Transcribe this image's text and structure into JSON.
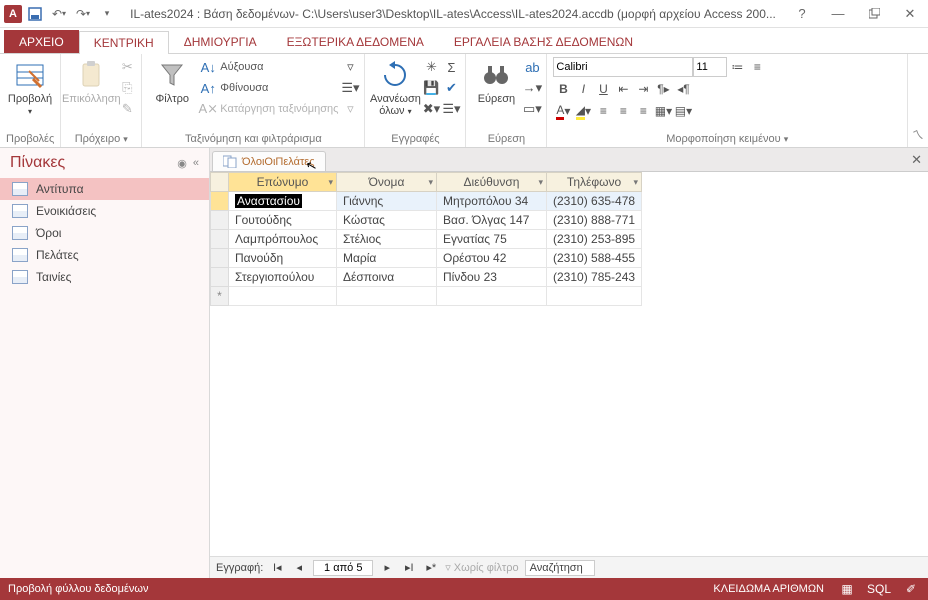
{
  "titlebar": {
    "app_glyph": "A",
    "title": "IL-ates2024 : Βάση δεδομένων- C:\\Users\\user3\\Desktop\\IL-ates\\Access\\IL-ates2024.accdb (μορφή αρχείου Access 200...",
    "help": "?"
  },
  "tabs": {
    "file": "ΑΡΧΕΙΟ",
    "home": "ΚΕΝΤΡΙΚΗ",
    "create": "ΔΗΜΙΟΥΡΓΙΑ",
    "external": "ΕΞΩΤΕΡΙΚΑ ΔΕΔΟΜΕΝΑ",
    "dbtools": "ΕΡΓΑΛΕΙΑ ΒΑΣΗΣ ΔΕΔΟΜΕΝΩΝ"
  },
  "ribbon": {
    "views": {
      "view": "Προβολή",
      "group": "Προβολές"
    },
    "clipboard": {
      "paste": "Επικόλληση",
      "group": "Πρόχειρο"
    },
    "sortfilter": {
      "filter": "Φίλτρο",
      "asc": "Αύξουσα",
      "desc": "Φθίνουσα",
      "clear_sort": "Κατάργηση ταξινόμησης",
      "group": "Ταξινόμηση και φιλτράρισμα"
    },
    "records": {
      "refresh": "Ανανέωση όλων",
      "group": "Εγγραφές"
    },
    "find": {
      "find": "Εύρεση",
      "group": "Εύρεση"
    },
    "textfmt": {
      "font_name": "Calibri",
      "font_size": "11",
      "group": "Μορφοποίηση κειμένου"
    }
  },
  "navpane": {
    "title": "Πίνακες",
    "items": [
      "Αντίτυπα",
      "Ενοικιάσεις",
      "Όροι",
      "Πελάτες",
      "Ταινίες"
    ],
    "selected_index": 0
  },
  "document": {
    "tab_label": "ΌλοιΟιΠελάτες",
    "columns": [
      "Επώνυμο",
      "Όνομα",
      "Διεύθυνση",
      "Τηλέφωνο"
    ],
    "rows": [
      {
        "lastname": "Αναστασίου",
        "firstname": "Γιάννης",
        "address": "Μητροπόλου 34",
        "phone": "(2310) 635-478"
      },
      {
        "lastname": "Γουτούδης",
        "firstname": "Κώστας",
        "address": "Βασ. Όλγας 147",
        "phone": "(2310) 888-771"
      },
      {
        "lastname": "Λαμπρόπουλος",
        "firstname": "Στέλιος",
        "address": "Εγνατίας 75",
        "phone": "(2310) 253-895"
      },
      {
        "lastname": "Πανούδη",
        "firstname": "Μαρία",
        "address": "Ορέστου 42",
        "phone": "(2310) 588-455"
      },
      {
        "lastname": "Στεργιοπούλου",
        "firstname": "Δέσποινα",
        "address": "Πίνδου 23",
        "phone": "(2310) 785-243"
      }
    ],
    "newrow_marker": "*"
  },
  "recnav": {
    "label": "Εγγραφή:",
    "position": "1 από 5",
    "no_filter": "Χωρίς φίλτρο",
    "search": "Αναζήτηση"
  },
  "statusbar": {
    "left": "Προβολή φύλλου δεδομένων",
    "caps": "ΚΛΕΙΔΩΜΑ ΑΡΙΘΜΩΝ",
    "sql": "SQL"
  }
}
